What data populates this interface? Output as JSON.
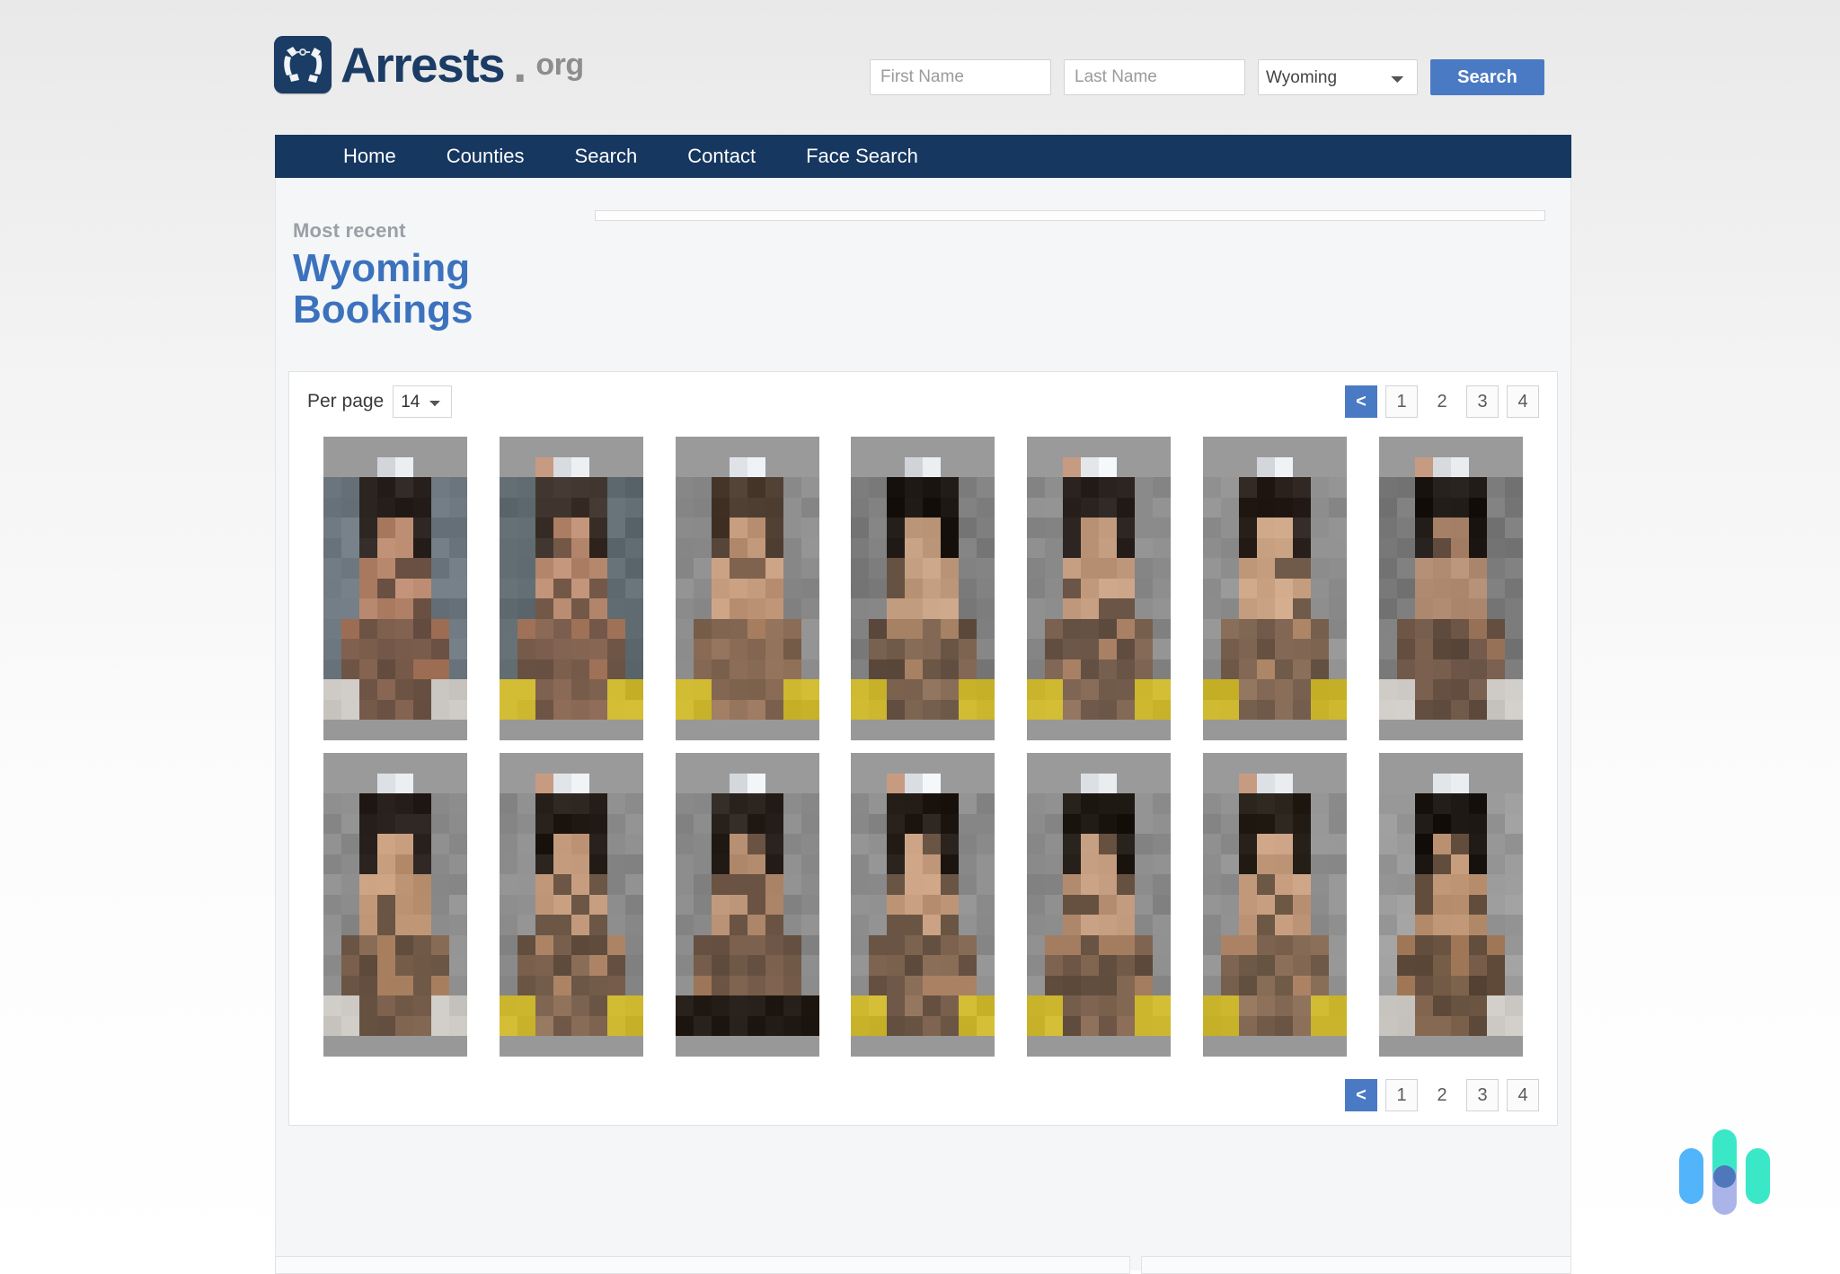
{
  "brand": {
    "name": "Arrests",
    "dot": ".",
    "tld": "org",
    "logo_icon": "handcuffs-icon",
    "logo_color": "#1b3c64"
  },
  "search": {
    "first_name_placeholder": "First Name",
    "first_name_value": "",
    "last_name_placeholder": "Last Name",
    "last_name_value": "",
    "state_selected": "Wyoming",
    "state_options": [
      "Wyoming"
    ],
    "button_label": "Search",
    "button_color": "#4a7ac4"
  },
  "nav": {
    "background": "#163760",
    "items": [
      {
        "label": "Home"
      },
      {
        "label": "Counties"
      },
      {
        "label": "Search"
      },
      {
        "label": "Contact"
      },
      {
        "label": "Face Search"
      }
    ]
  },
  "page_header": {
    "kicker": "Most recent",
    "title_line1": "Wyoming",
    "title_line2": "Bookings",
    "title_color": "#3c72bd"
  },
  "results": {
    "per_page_label": "Per page",
    "per_page_value": "14",
    "per_page_options": [
      "14"
    ],
    "pagination": [
      {
        "label": "<",
        "active": true
      },
      {
        "label": "1",
        "active": false,
        "boxed": true
      },
      {
        "label": "2",
        "active": false,
        "boxed": false
      },
      {
        "label": "3",
        "active": false,
        "boxed": true
      },
      {
        "label": "4",
        "active": false,
        "boxed": true
      }
    ],
    "thumbnail_count": 14,
    "columns": 7,
    "rows": 2,
    "thumbnails": [
      {
        "alt": "booking-photo-1",
        "jumpsuit": "none",
        "bg": "#6d7880",
        "hair": "#2b2420",
        "skin": "#b5866c"
      },
      {
        "alt": "booking-photo-2",
        "jumpsuit": "yellow",
        "bg": "#5f6b70",
        "hair": "#3a2f28",
        "skin": "#b88a70"
      },
      {
        "alt": "booking-photo-3",
        "jumpsuit": "yellow",
        "bg": "#8b8b8b",
        "hair": "#4a3a2e",
        "skin": "#c09678"
      },
      {
        "alt": "booking-photo-4",
        "jumpsuit": "yellow",
        "bg": "#7e7e7e",
        "hair": "#1d1714",
        "skin": "#c09a7c"
      },
      {
        "alt": "booking-photo-5",
        "jumpsuit": "yellow",
        "bg": "#8a8a8a",
        "hair": "#241d19",
        "skin": "#c19a7e"
      },
      {
        "alt": "booking-photo-6",
        "jumpsuit": "yellow",
        "bg": "#8f8f8f",
        "hair": "#2a211c",
        "skin": "#c69f80"
      },
      {
        "alt": "booking-photo-7",
        "jumpsuit": "none",
        "bg": "#7a7a7a",
        "hair": "#1e1815",
        "skin": "#b08a70"
      },
      {
        "alt": "booking-photo-8",
        "jumpsuit": "none",
        "bg": "#8d8d8d",
        "hair": "#241c18",
        "skin": "#c09878"
      },
      {
        "alt": "booking-photo-9",
        "jumpsuit": "yellow",
        "bg": "#8b8b8b",
        "hair": "#231b16",
        "skin": "#c59d7e"
      },
      {
        "alt": "booking-photo-10",
        "jumpsuit": "black",
        "bg": "#8a8a8a",
        "hair": "#2b231d",
        "skin": "#b68e72"
      },
      {
        "alt": "booking-photo-11",
        "jumpsuit": "yellow",
        "bg": "#8c8c8c",
        "hair": "#221b16",
        "skin": "#c39b7c"
      },
      {
        "alt": "booking-photo-12",
        "jumpsuit": "yellow",
        "bg": "#8b8b8b",
        "hair": "#1f1914",
        "skin": "#bd9578"
      },
      {
        "alt": "booking-photo-13",
        "jumpsuit": "yellow",
        "bg": "#8e8e8e",
        "hair": "#262019",
        "skin": "#c49c7d"
      },
      {
        "alt": "booking-photo-14",
        "jumpsuit": "none",
        "bg": "#9a9a9a",
        "hair": "#1c1612",
        "skin": "#b89070"
      }
    ]
  },
  "widget": {
    "name": "chat-widget",
    "colors": [
      "#52b4fb",
      "#3ae8c8",
      "#aab4e8",
      "#4e78bb"
    ]
  }
}
